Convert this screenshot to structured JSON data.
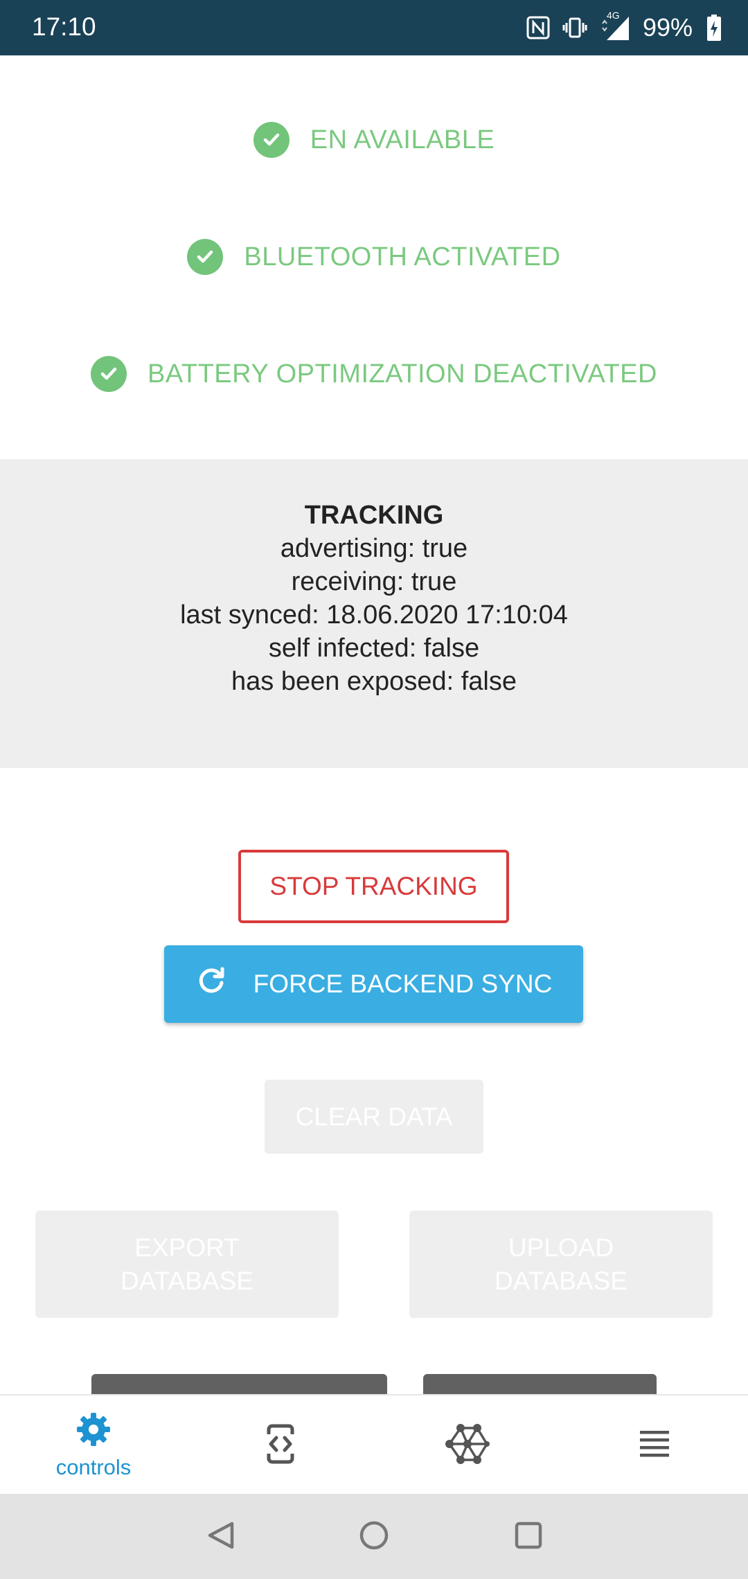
{
  "status_bar": {
    "time": "17:10",
    "network_label": "4G",
    "battery": "99%"
  },
  "checks": [
    {
      "label": "EN AVAILABLE"
    },
    {
      "label": "BLUETOOTH ACTIVATED"
    },
    {
      "label": "BATTERY OPTIMIZATION DEACTIVATED"
    }
  ],
  "tracking": {
    "title": "TRACKING",
    "advertising": "advertising: true",
    "receiving": "receiving: true",
    "last_synced": "last synced: 18.06.2020 17:10:04",
    "self_infected": "self infected: false",
    "exposed": "has been exposed: false"
  },
  "buttons": {
    "stop_tracking": "STOP TRACKING",
    "force_sync": "FORCE BACKEND SYNC",
    "clear_data": "CLEAR DATA",
    "export_db_line1": "EXPORT",
    "export_db_line2": "DATABASE",
    "upload_db_line1": "UPLOAD",
    "upload_db_line2": "DATABASE"
  },
  "bottom_nav": {
    "items": [
      {
        "label": "controls",
        "icon": "gear-icon",
        "active": true
      },
      {
        "icon": "code-brackets-icon"
      },
      {
        "icon": "network-icon"
      },
      {
        "icon": "list-icon"
      }
    ]
  },
  "colors": {
    "status_bar": "#1a4256",
    "check_green": "#72c47a",
    "danger_red": "#d83a3a",
    "primary_blue": "#3aaee2",
    "nav_active": "#1d93d2"
  }
}
